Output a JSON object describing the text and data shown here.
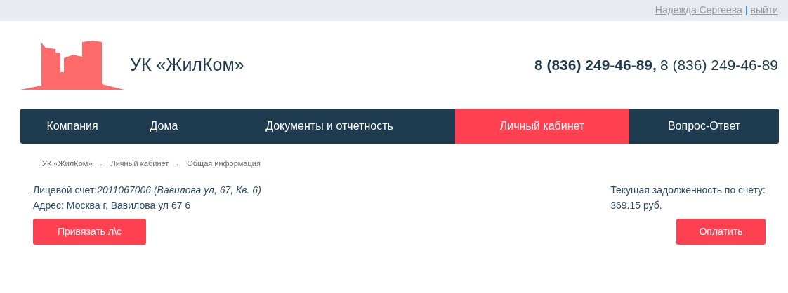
{
  "top_bar": {
    "user": "Надежда Сергеева",
    "divider": "|",
    "logout": "выйти"
  },
  "header": {
    "company": "УК «ЖилКом»",
    "phones": [
      {
        "text": "8 (836) 249-46-89,",
        "bold": true
      },
      {
        "text": "8 (836) 249-46-89",
        "bold": false
      }
    ]
  },
  "nav": [
    {
      "label": "Компания",
      "selected": false
    },
    {
      "label": "Дома",
      "selected": false
    },
    {
      "label": "Документы и отчетность",
      "selected": false
    },
    {
      "label": "Личный кабинет",
      "selected": true
    },
    {
      "label": "Вопрос-Ответ",
      "selected": false
    }
  ],
  "breadcrumb": [
    {
      "kind": "link",
      "text": "УК «ЖилКом»"
    },
    {
      "kind": "separator",
      "text": "→"
    },
    {
      "kind": "link",
      "text": "Личный кабинет"
    },
    {
      "kind": "separator",
      "text": "→"
    },
    {
      "kind": "current",
      "text": "Общая информация"
    }
  ],
  "account": {
    "label": "Лицевой счет:",
    "value": "2011067006 (Вавилова ул, 67, Кв. 6)",
    "address": "Адрес: Москва г, Вавилова ул 67 6",
    "button": "Привязать л\\с"
  },
  "debt": {
    "label": "Текущая задолженность по счету:",
    "amount": "369.15 руб.",
    "button": "Оплатить"
  }
}
